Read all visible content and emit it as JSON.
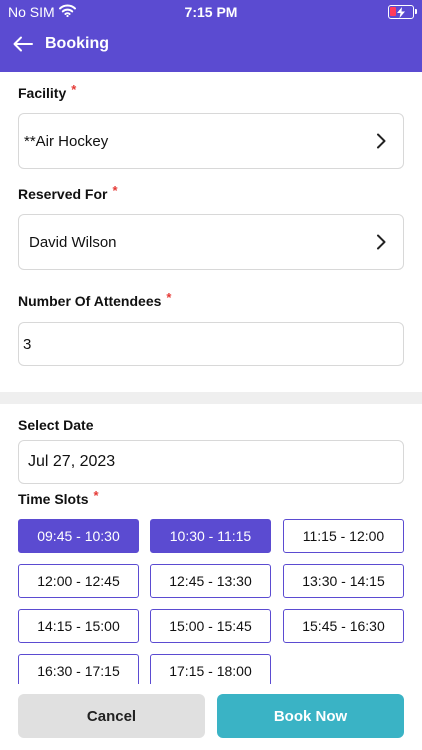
{
  "status_bar": {
    "carrier": "No SIM",
    "time": "7:15 PM"
  },
  "header": {
    "title": "Booking"
  },
  "form": {
    "facility": {
      "label": "Facility",
      "value": "**Air Hockey"
    },
    "reserved_for": {
      "label": "Reserved For",
      "value": "David Wilson"
    },
    "attendees": {
      "label": "Number Of Attendees",
      "value": "3"
    },
    "select_date": {
      "label": "Select Date",
      "value": "Jul 27, 2023"
    },
    "time_slots": {
      "label": "Time Slots",
      "slots": [
        {
          "label": "09:45 - 10:30",
          "selected": true
        },
        {
          "label": "10:30 - 11:15",
          "selected": true
        },
        {
          "label": "11:15 - 12:00",
          "selected": false
        },
        {
          "label": "12:00 - 12:45",
          "selected": false
        },
        {
          "label": "12:45 - 13:30",
          "selected": false
        },
        {
          "label": "13:30 - 14:15",
          "selected": false
        },
        {
          "label": "14:15 - 15:00",
          "selected": false
        },
        {
          "label": "15:00 - 15:45",
          "selected": false
        },
        {
          "label": "15:45 - 16:30",
          "selected": false
        },
        {
          "label": "16:30 - 17:15",
          "selected": false
        },
        {
          "label": "17:15 - 18:00",
          "selected": false
        }
      ]
    }
  },
  "required_marker": "*",
  "footer": {
    "cancel_label": "Cancel",
    "book_label": "Book Now"
  },
  "colors": {
    "primary": "#5b4bd1",
    "accent": "#3ab3c5",
    "required": "#e53935"
  }
}
